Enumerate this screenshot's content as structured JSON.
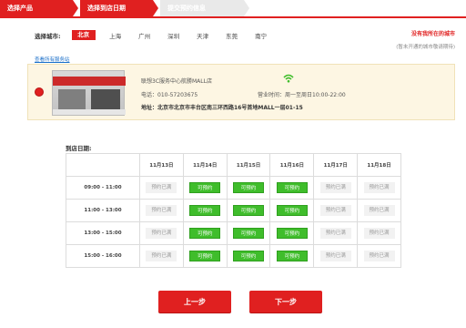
{
  "steps": [
    {
      "label": "选择产品",
      "state": "active"
    },
    {
      "label": "选择到店日期",
      "state": "active"
    },
    {
      "label": "提交预约信息",
      "state": "inactive"
    }
  ],
  "city": {
    "label": "选择城市:",
    "options": [
      "北京",
      "上海",
      "广州",
      "深圳",
      "天津",
      "东莞",
      "南宁"
    ],
    "selected": "北京",
    "hint_link": "没有我所在的城市",
    "hint_note": "(暂未开通的城市敬请期待)",
    "view_all": "查看所有服务站"
  },
  "store": {
    "name": "联想3C服务中心航勝MALL店",
    "phone": "电话：010-57203675",
    "hours": "营业时间：周一至周日10:00-22:00",
    "address": "地址：北京市北京市丰台区南三环西路16号首地MALL一层01-15",
    "icon": "wifi-icon"
  },
  "schedule": {
    "label": "到店日期:",
    "dates": [
      "11月13日",
      "11月14日",
      "11月15日",
      "11月16日",
      "11月17日",
      "11月18日"
    ],
    "rows": [
      {
        "time": "09:00 - 11:00",
        "slots": [
          "预约已满",
          "可预约",
          "可预约",
          "可预约",
          "预约已满",
          "预约已满"
        ]
      },
      {
        "time": "11:00 - 13:00",
        "slots": [
          "预约已满",
          "可预约",
          "可预约",
          "可预约",
          "预约已满",
          "预约已满"
        ]
      },
      {
        "time": "13:00 - 15:00",
        "slots": [
          "预约已满",
          "可预约",
          "可预约",
          "可预约",
          "预约已满",
          "预约已满"
        ]
      },
      {
        "time": "15:00 - 16:00",
        "slots": [
          "预约已满",
          "可预约",
          "可预约",
          "可预约",
          "预约已满",
          "预约已满"
        ]
      }
    ],
    "available_text": "可预约"
  },
  "buttons": {
    "prev": "上一步",
    "next": "下一步"
  },
  "colors": {
    "brand": "#e02020",
    "available": "#3fbd2b",
    "full": "#f2f2f2",
    "card": "#fdf6e3"
  }
}
